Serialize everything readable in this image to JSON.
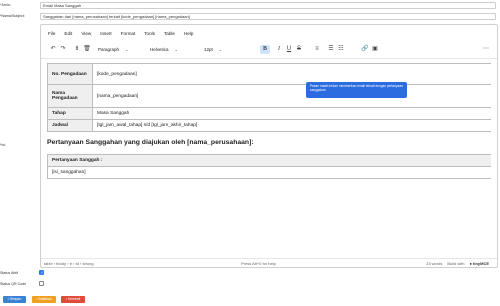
{
  "form": {
    "jenis_label": "*Jenis:",
    "jenis_value": "Email Masa Sanggah",
    "subject_label": "*Nama/Subject:",
    "subject_value": "Sanggahan dari [nama_perusahaan] terkait [kode_pengadaan] [nama_pengadaan]",
    "isi_label": "*Isi:",
    "status_aktif_label": "Status Aktif",
    "status_aktif_checked": true,
    "status_qr_label": "Status QR Code",
    "status_qr_checked": false
  },
  "editor": {
    "menu": [
      "File",
      "Edit",
      "View",
      "Insert",
      "Format",
      "Tools",
      "Table",
      "Help"
    ],
    "toolbar": {
      "block_format": "Paragraph",
      "font_family": "Helvetica",
      "font_size": "12pt"
    },
    "info_table": [
      {
        "key": "No. Pengadaan",
        "value": "[kode_pengadaan]"
      },
      {
        "key": "Nama Pengadaan",
        "value": "[nama_pengadaan]"
      },
      {
        "key": "Tahap",
        "value": "Masa Sanggah"
      },
      {
        "key": "Jadwal",
        "value": "[tgl_jam_awal_tahap] s/d [tgl_jam_akhir_tahap]"
      }
    ],
    "heading": "Pertanyaan Sanggahan yang diajukan oleh [nama_perusahaan]:",
    "question_table": {
      "header": "Pertanyaan Sanggah :",
      "value": "[isi_sanggahan]"
    },
    "tooltip": "Pesan masih belum memberikan email terkait dengan pertanyaan sanggahan",
    "status": {
      "path": "table › tbody › tr › td › strong",
      "hint": "Press Alt+0 for help",
      "words": "23 words",
      "built_with": "Build with",
      "brand": "tinyMCE"
    }
  },
  "buttons": [
    {
      "label": "Simpan",
      "color": "#3b82d6"
    },
    {
      "label": "Batalkan",
      "color": "#f0a020"
    },
    {
      "label": "Kembali",
      "color": "#e04b3a"
    }
  ]
}
